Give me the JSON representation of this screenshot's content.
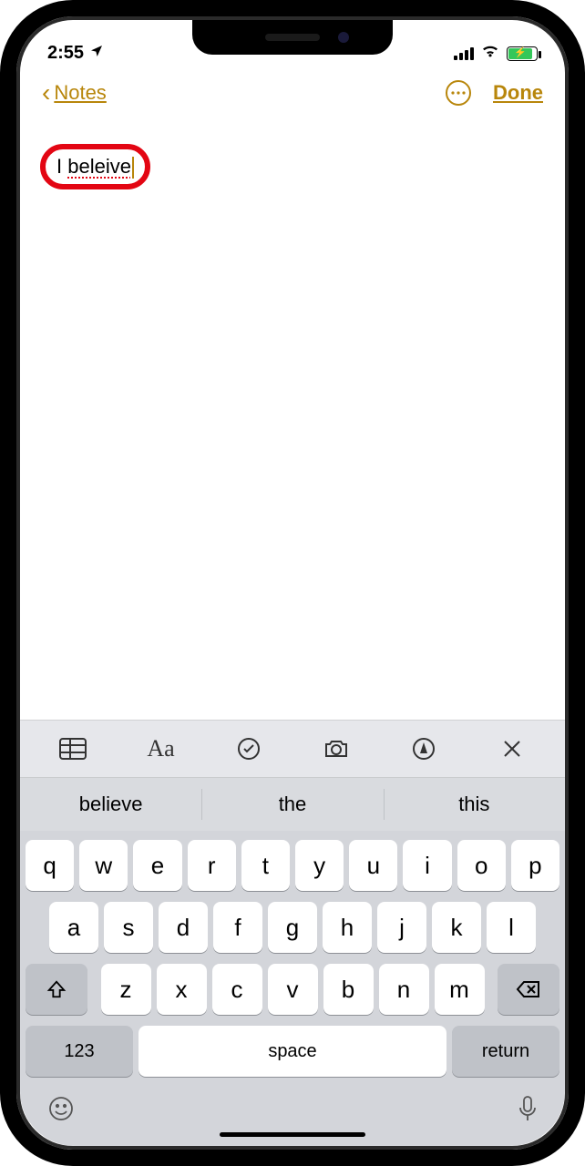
{
  "status": {
    "time": "2:55",
    "location_icon": "location-arrow"
  },
  "nav": {
    "back_label": "Notes",
    "done_label": "Done"
  },
  "note": {
    "prefix": "I ",
    "misspelled": "beleive"
  },
  "toolbar": {
    "table": "table-icon",
    "format": "Aa",
    "checklist": "checklist-icon",
    "camera": "camera-icon",
    "markup": "markup-icon",
    "close": "close-icon"
  },
  "suggestions": [
    "believe",
    "the",
    "this"
  ],
  "keyboard": {
    "row1": [
      "q",
      "w",
      "e",
      "r",
      "t",
      "y",
      "u",
      "i",
      "o",
      "p"
    ],
    "row2": [
      "a",
      "s",
      "d",
      "f",
      "g",
      "h",
      "j",
      "k",
      "l"
    ],
    "row3": [
      "z",
      "x",
      "c",
      "v",
      "b",
      "n",
      "m"
    ],
    "numbers_label": "123",
    "space_label": "space",
    "return_label": "return"
  }
}
